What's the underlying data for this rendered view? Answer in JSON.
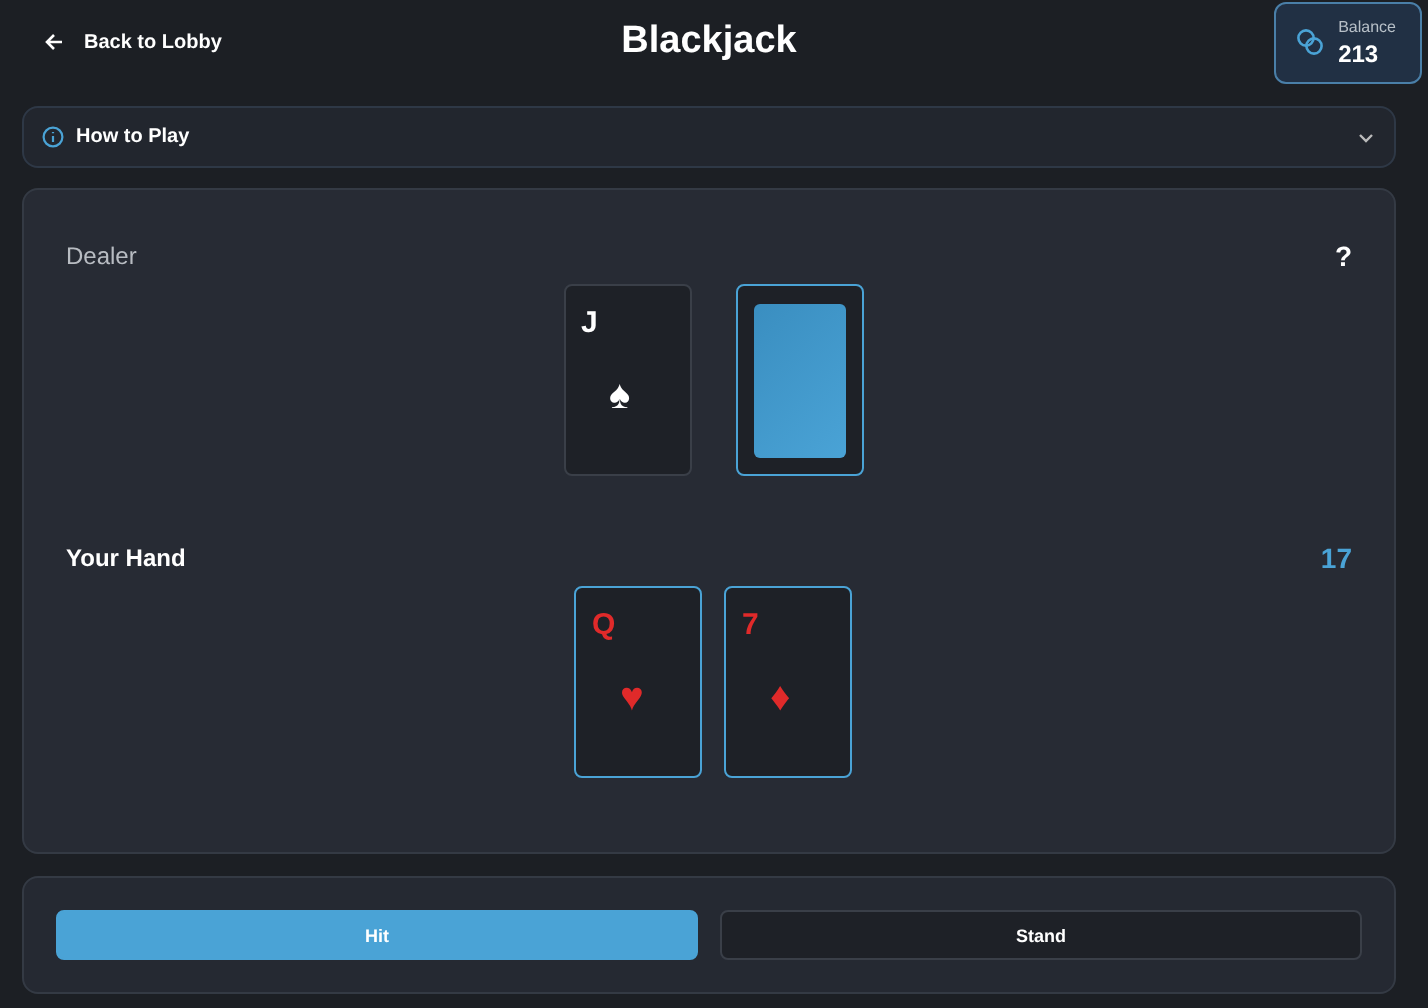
{
  "header": {
    "back_link": "Back to Lobby",
    "title": "Blackjack",
    "balance": {
      "label": "Balance",
      "value": "213"
    }
  },
  "how_to_play": {
    "label": "How to Play",
    "expanded": false
  },
  "hands": [
    {
      "label": "Dealer",
      "score": "?",
      "cards": [
        {
          "kind": "face",
          "rank": "J",
          "suit": "♠",
          "red": false,
          "highlighted": false
        },
        {
          "kind": "back",
          "highlighted": true
        }
      ]
    },
    {
      "label": "Your Hand",
      "score": "17",
      "cards": [
        {
          "kind": "face",
          "rank": "Q",
          "suit": "♥",
          "red": true,
          "highlighted": true
        },
        {
          "kind": "face",
          "rank": "7",
          "suit": "♦",
          "red": true,
          "highlighted": true
        }
      ]
    }
  ],
  "actions": [
    {
      "label": "Hit",
      "primary": true
    },
    {
      "label": "Stand",
      "primary": false
    }
  ]
}
